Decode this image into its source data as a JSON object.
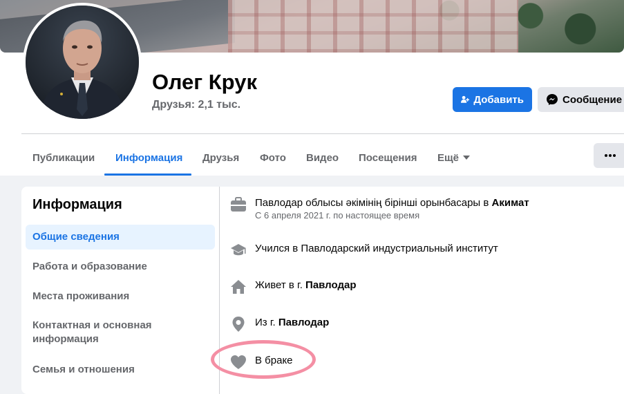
{
  "profile": {
    "name": "Олег Крук",
    "friends": "Друзья: 2,1 тыс."
  },
  "actions": {
    "add_label": "Добавить",
    "message_label": "Сообщение"
  },
  "tabs": [
    {
      "label": "Публикации"
    },
    {
      "label": "Информация",
      "active": true
    },
    {
      "label": "Друзья"
    },
    {
      "label": "Фото"
    },
    {
      "label": "Видео"
    },
    {
      "label": "Посещения"
    },
    {
      "label": "Ещё"
    }
  ],
  "about": {
    "title": "Информация",
    "nav": [
      {
        "label": "Общие сведения",
        "active": true
      },
      {
        "label": "Работа и образование"
      },
      {
        "label": "Места проживания"
      },
      {
        "label": "Контактная и основная информация"
      },
      {
        "label": "Семья и отношения"
      }
    ],
    "rows": [
      {
        "icon": "briefcase-icon",
        "prefix": "Павлодар облысы әкімінің бірінші орынбасары в ",
        "bold": "Акимат",
        "sub": "С 6 апреля 2021 г. по настоящее время"
      },
      {
        "icon": "graduation-cap-icon",
        "prefix": "Учился в Павлодарский индустриальный институт",
        "bold": ""
      },
      {
        "icon": "home-icon",
        "prefix": "Живет в г. ",
        "bold": "Павлодар"
      },
      {
        "icon": "location-pin-icon",
        "prefix": "Из г. ",
        "bold": "Павлодар"
      },
      {
        "icon": "heart-icon",
        "prefix": "В браке",
        "bold": ""
      }
    ]
  },
  "colors": {
    "accent": "#1b74e4",
    "highlight": "#f48fa4"
  }
}
